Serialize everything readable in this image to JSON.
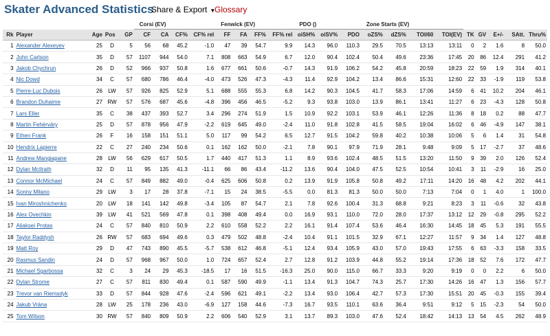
{
  "header": {
    "title": "Skater Advanced Statistics",
    "share_label": "Share & Export",
    "share_caret": "▼",
    "glossary_label": "Glossary"
  },
  "groups": {
    "corsi": "Corsi (EV)",
    "fenwick": "Fenwick (EV)",
    "pdo": "PDO ()",
    "zone": "Zone Starts (EV)"
  },
  "columns": [
    "Rk",
    "Player",
    "Age",
    "Pos",
    "GP",
    "CF",
    "CA",
    "CF%",
    "CF% rel",
    "FF",
    "FA",
    "FF%",
    "FF% rel",
    "oiSH%",
    "oiSV%",
    "PDO",
    "oZS%",
    "dZS%",
    "TOI/60",
    "TOI(EV)",
    "TK",
    "GV",
    "E+/-",
    "SAtt.",
    "Thru%"
  ],
  "rows": [
    [
      "1",
      "Alexander Alexeyev",
      "25",
      "D",
      "5",
      "56",
      "68",
      "45.2",
      "-1.0",
      "47",
      "39",
      "54.7",
      "9.9",
      "14.3",
      "96.0",
      "110.3",
      "29.5",
      "70.5",
      "13:13",
      "13:11",
      "0",
      "2",
      "1.6",
      "8",
      "50.0"
    ],
    [
      "2",
      "John Carlson",
      "35",
      "D",
      "57",
      "1107",
      "944",
      "54.0",
      "7.1",
      "808",
      "663",
      "54.9",
      "6.7",
      "12.0",
      "90.4",
      "102.4",
      "50.4",
      "49.6",
      "23:36",
      "17:45",
      "20",
      "86",
      "12.4",
      "291",
      "41.2"
    ],
    [
      "3",
      "Jakob Chychrun",
      "26",
      "D",
      "52",
      "966",
      "937",
      "50.8",
      "1.6",
      "677",
      "661",
      "50.6",
      "-0.7",
      "14.3",
      "91.9",
      "106.2",
      "54.2",
      "45.8",
      "20:59",
      "18:23",
      "22",
      "59",
      "1.9",
      "314",
      "40.1"
    ],
    [
      "4",
      "Nic Dowd",
      "34",
      "C",
      "57",
      "680",
      "786",
      "46.4",
      "-4.0",
      "473",
      "526",
      "47.3",
      "-4.3",
      "11.4",
      "92.9",
      "104.2",
      "13.4",
      "86.6",
      "15:31",
      "12:60",
      "22",
      "33",
      "-1.9",
      "119",
      "53.8"
    ],
    [
      "5",
      "Pierre-Luc Dubois",
      "26",
      "LW",
      "57",
      "926",
      "825",
      "52.9",
      "5.1",
      "688",
      "555",
      "55.3",
      "6.8",
      "14.2",
      "90.3",
      "104.5",
      "41.7",
      "58.3",
      "17:06",
      "14:59",
      "6",
      "41",
      "10.2",
      "204",
      "46.1"
    ],
    [
      "6",
      "Brandon Duhaime",
      "27",
      "RW",
      "57",
      "576",
      "687",
      "45.6",
      "-4.8",
      "396",
      "456",
      "46.5",
      "-5.2",
      "9.3",
      "93.8",
      "103.0",
      "13.9",
      "86.1",
      "13:41",
      "11:27",
      "6",
      "23",
      "-4.3",
      "128",
      "50.8"
    ],
    [
      "7",
      "Lars Eller",
      "35",
      "C",
      "38",
      "437",
      "393",
      "52.7",
      "3.4",
      "296",
      "274",
      "51.9",
      "1.5",
      "10.9",
      "92.2",
      "103.1",
      "53.9",
      "46.1",
      "12:26",
      "11:36",
      "8",
      "18",
      "0.2",
      "88",
      "47.7"
    ],
    [
      "8",
      "Martin Fehérváry",
      "25",
      "D",
      "57",
      "878",
      "956",
      "47.9",
      "-2.2",
      "619",
      "645",
      "49.0",
      "-2.4",
      "11.0",
      "91.8",
      "102.8",
      "41.5",
      "58.5",
      "19:04",
      "16:02",
      "6",
      "46",
      "-4.9",
      "147",
      "38.1"
    ],
    [
      "9",
      "Ethen Frank",
      "26",
      "F",
      "16",
      "158",
      "151",
      "51.1",
      "5.0",
      "117",
      "99",
      "54.2",
      "6.5",
      "12.7",
      "91.5",
      "104.2",
      "59.8",
      "40.2",
      "10:38",
      "10:06",
      "5",
      "6",
      "1.4",
      "31",
      "54.8"
    ],
    [
      "10",
      "Hendrix Lapierre",
      "22",
      "C",
      "27",
      "240",
      "234",
      "50.6",
      "0.1",
      "162",
      "162",
      "50.0",
      "-2.1",
      "7.8",
      "90.1",
      "97.9",
      "71.9",
      "28.1",
      "9:48",
      "9:09",
      "5",
      "17",
      "-2.7",
      "37",
      "48.6"
    ],
    [
      "11",
      "Andrew Mangiapane",
      "28",
      "LW",
      "56",
      "629",
      "617",
      "50.5",
      "1.7",
      "440",
      "417",
      "51.3",
      "1.1",
      "8.9",
      "93.6",
      "102.4",
      "48.5",
      "51.5",
      "13:20",
      "11:50",
      "9",
      "39",
      "2.0",
      "126",
      "52.4"
    ],
    [
      "12",
      "Dylan McIlrath",
      "32",
      "D",
      "11",
      "95",
      "135",
      "41.3",
      "-11.1",
      "66",
      "86",
      "43.4",
      "-11.2",
      "13.6",
      "90.4",
      "104.0",
      "47.5",
      "52.5",
      "10:54",
      "10:41",
      "3",
      "11",
      "-2.9",
      "16",
      "25.0"
    ],
    [
      "13",
      "Connor McMichael",
      "24",
      "C",
      "57",
      "849",
      "882",
      "49.0",
      "-0.4",
      "625",
      "606",
      "50.8",
      "0.2",
      "13.9",
      "91.9",
      "105.8",
      "50.8",
      "49.2",
      "17:11",
      "14:20",
      "16",
      "48",
      "4.2",
      "202",
      "44.1"
    ],
    [
      "14",
      "Sonny Milano",
      "29",
      "LW",
      "3",
      "17",
      "28",
      "37.8",
      "-7.1",
      "15",
      "24",
      "38.5",
      "-5.5",
      "0.0",
      "81.3",
      "81.3",
      "50.0",
      "50.0",
      "7:13",
      "7:04",
      "0",
      "1",
      "4.0",
      "1",
      "100.0"
    ],
    [
      "15",
      "Ivan Miroshnichenko",
      "20",
      "LW",
      "18",
      "141",
      "142",
      "49.8",
      "-3.4",
      "105",
      "87",
      "54.7",
      "2.1",
      "7.8",
      "92.6",
      "100.4",
      "31.3",
      "68.8",
      "9:21",
      "8:23",
      "3",
      "11",
      "-0.6",
      "32",
      "43.8"
    ],
    [
      "16",
      "Alex Ovechkin",
      "39",
      "LW",
      "41",
      "521",
      "569",
      "47.8",
      "0.1",
      "398",
      "408",
      "49.4",
      "0.0",
      "16.9",
      "93.1",
      "110.0",
      "72.0",
      "28.0",
      "17:37",
      "13:12",
      "12",
      "29",
      "-0.8",
      "295",
      "52.2"
    ],
    [
      "17",
      "Aliaksei Protas",
      "24",
      "C",
      "57",
      "840",
      "810",
      "50.9",
      "2.2",
      "610",
      "558",
      "52.2",
      "2.2",
      "16.1",
      "91.4",
      "107.4",
      "53.6",
      "46.4",
      "16:30",
      "14:45",
      "18",
      "45",
      "5.3",
      "191",
      "55.5"
    ],
    [
      "18",
      "Taylor Raddysh",
      "26",
      "RW",
      "57",
      "683",
      "694",
      "49.6",
      "0.3",
      "479",
      "502",
      "48.8",
      "-2.4",
      "10.4",
      "91.1",
      "101.5",
      "32.9",
      "67.1",
      "12:27",
      "11:57",
      "9",
      "34",
      "1.4",
      "127",
      "48.8"
    ],
    [
      "19",
      "Matt Roy",
      "29",
      "D",
      "47",
      "743",
      "890",
      "45.5",
      "-5.7",
      "538",
      "612",
      "46.8",
      "-5.1",
      "12.4",
      "93.4",
      "105.9",
      "43.0",
      "57.0",
      "19:43",
      "17:55",
      "6",
      "63",
      "-3.3",
      "158",
      "33.5"
    ],
    [
      "20",
      "Rasmus Sandin",
      "24",
      "D",
      "57",
      "968",
      "967",
      "50.0",
      "1.0",
      "724",
      "657",
      "52.4",
      "2.7",
      "12.8",
      "91.2",
      "103.9",
      "44.8",
      "55.2",
      "19:14",
      "17:36",
      "18",
      "52",
      "7.6",
      "172",
      "47.7"
    ],
    [
      "21",
      "Michael Sgarbossa",
      "32",
      "C",
      "3",
      "24",
      "29",
      "45.3",
      "-18.5",
      "17",
      "16",
      "51.5",
      "-16.3",
      "25.0",
      "90.0",
      "115.0",
      "66.7",
      "33.3",
      "9:20",
      "9:19",
      "0",
      "0",
      "2.2",
      "6",
      "50.0"
    ],
    [
      "22",
      "Dylan Strome",
      "27",
      "C",
      "57",
      "811",
      "830",
      "49.4",
      "0.1",
      "587",
      "590",
      "49.9",
      "-1.1",
      "13.4",
      "91.3",
      "104.7",
      "74.3",
      "25.7",
      "17:30",
      "14:26",
      "16",
      "47",
      "1.3",
      "156",
      "57.7"
    ],
    [
      "23",
      "Trevor van Riemsdyk",
      "33",
      "D",
      "57",
      "844",
      "928",
      "47.6",
      "-2.4",
      "596",
      "621",
      "49.1",
      "-2.2",
      "13.4",
      "93.0",
      "106.4",
      "42.7",
      "57.3",
      "17:30",
      "15:51",
      "20",
      "45",
      "-0.3",
      "155",
      "39.4"
    ],
    [
      "24",
      "Jakub Vrána",
      "28",
      "LW",
      "25",
      "178",
      "236",
      "43.0",
      "-6.9",
      "127",
      "158",
      "44.6",
      "-7.3",
      "16.7",
      "93.5",
      "110.1",
      "63.6",
      "36.4",
      "9:51",
      "9:12",
      "5",
      "15",
      "-2.3",
      "54",
      "50.0"
    ],
    [
      "25",
      "Tom Wilson",
      "30",
      "RW",
      "57",
      "840",
      "809",
      "50.9",
      "2.2",
      "606",
      "540",
      "52.9",
      "3.1",
      "13.7",
      "89.3",
      "103.0",
      "47.6",
      "52.4",
      "18:42",
      "14:13",
      "13",
      "54",
      "4.5",
      "262",
      "48.9"
    ]
  ]
}
